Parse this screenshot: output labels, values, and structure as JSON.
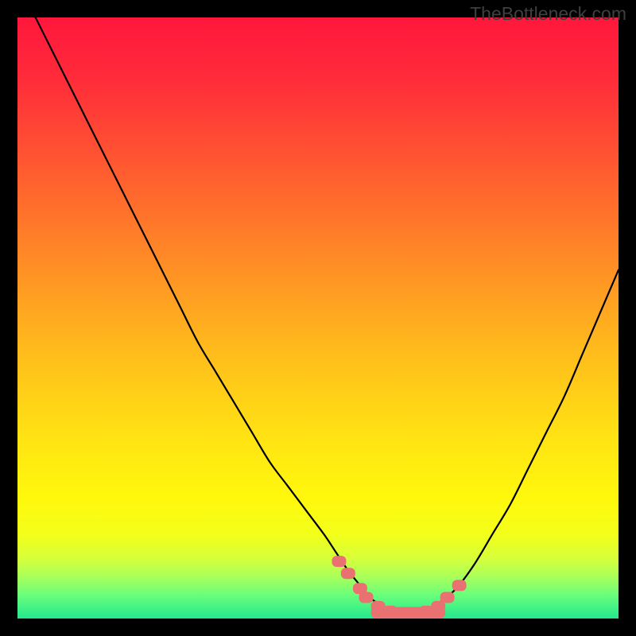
{
  "watermark": "TheBottleneck.com",
  "chart_data": {
    "type": "line",
    "title": "",
    "xlabel": "",
    "ylabel": "",
    "xlim": [
      0,
      100
    ],
    "ylim": [
      0,
      100
    ],
    "grid": false,
    "legend": false,
    "annotations": [],
    "series": [
      {
        "name": "bottleneck-curve",
        "x": [
          3,
          6,
          9,
          12,
          15,
          18,
          21,
          24,
          27,
          30,
          33,
          36,
          39,
          42,
          45,
          48,
          51,
          53,
          55,
          57,
          58,
          60,
          62,
          64,
          66,
          68,
          70,
          73,
          76,
          79,
          82,
          85,
          88,
          91,
          94,
          97,
          100
        ],
        "y": [
          100,
          94,
          88,
          82,
          76,
          70,
          64,
          58,
          52,
          46,
          41,
          36,
          31,
          26,
          22,
          18,
          14,
          11,
          8,
          5.5,
          4,
          2.5,
          1.5,
          1,
          1,
          1.5,
          2.5,
          5,
          9,
          14,
          19,
          25,
          31,
          37,
          44,
          51,
          58
        ]
      }
    ],
    "markers": {
      "name": "highlight-points",
      "x": [
        53.5,
        55,
        57,
        58,
        60,
        62,
        64,
        66,
        68,
        70,
        71.5,
        73.5
      ],
      "y": [
        9.5,
        7.5,
        5,
        3.5,
        2,
        1.2,
        1,
        1,
        1.2,
        2,
        3.5,
        5.5
      ]
    },
    "gradient_stops": [
      {
        "offset": 0.0,
        "color": "#ff173c"
      },
      {
        "offset": 0.1,
        "color": "#ff2b3a"
      },
      {
        "offset": 0.25,
        "color": "#ff5a30"
      },
      {
        "offset": 0.4,
        "color": "#ff8a26"
      },
      {
        "offset": 0.55,
        "color": "#ffba1c"
      },
      {
        "offset": 0.7,
        "color": "#ffe313"
      },
      {
        "offset": 0.8,
        "color": "#fff80c"
      },
      {
        "offset": 0.86,
        "color": "#f3ff1a"
      },
      {
        "offset": 0.9,
        "color": "#d6ff3a"
      },
      {
        "offset": 0.93,
        "color": "#aaff5a"
      },
      {
        "offset": 0.96,
        "color": "#6bff7a"
      },
      {
        "offset": 1.0,
        "color": "#23e88e"
      }
    ],
    "marker_color": "#e97171",
    "curve_color": "#000000"
  }
}
